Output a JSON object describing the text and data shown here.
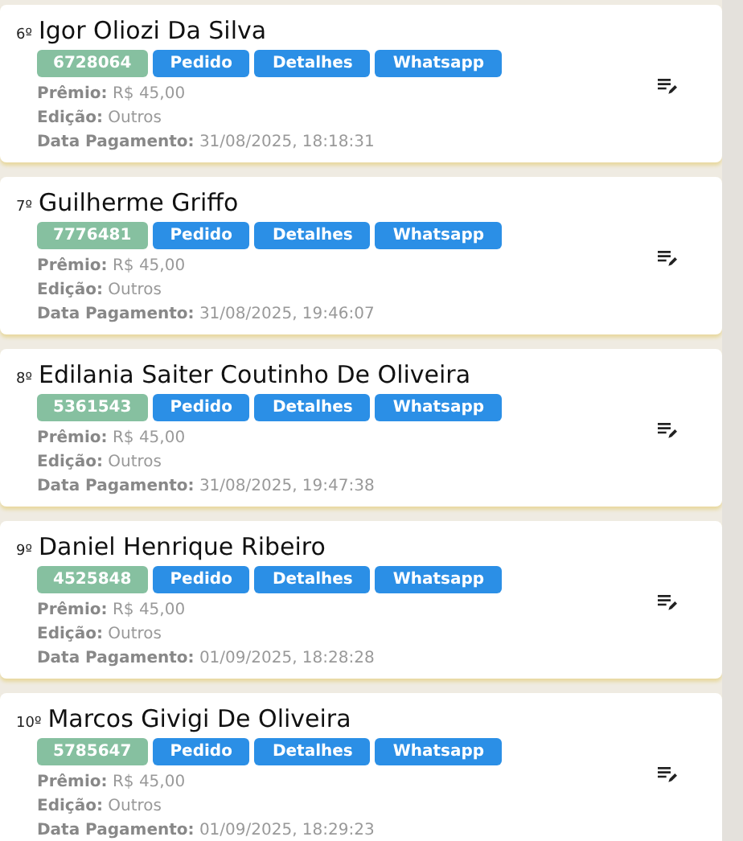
{
  "entries": [
    {
      "rank": "6º",
      "name": "Igor Oliozi Da Silva",
      "code": "6728064",
      "buttons": [
        "Pedido",
        "Detalhes",
        "Whatsapp"
      ],
      "fields": [
        {
          "label": "Prêmio:",
          "value": "R$ 45,00"
        },
        {
          "label": "Edição:",
          "value": "Outros"
        },
        {
          "label": "Data Pagamento:",
          "value": "31/08/2025, 18:18:31"
        }
      ]
    },
    {
      "rank": "7º",
      "name": "Guilherme Griffo",
      "code": "7776481",
      "buttons": [
        "Pedido",
        "Detalhes",
        "Whatsapp"
      ],
      "fields": [
        {
          "label": "Prêmio:",
          "value": "R$ 45,00"
        },
        {
          "label": "Edição:",
          "value": "Outros"
        },
        {
          "label": "Data Pagamento:",
          "value": "31/08/2025, 19:46:07"
        }
      ]
    },
    {
      "rank": "8º",
      "name": "Edilania Saiter Coutinho De Oliveira",
      "code": "5361543",
      "buttons": [
        "Pedido",
        "Detalhes",
        "Whatsapp"
      ],
      "fields": [
        {
          "label": "Prêmio:",
          "value": "R$ 45,00"
        },
        {
          "label": "Edição:",
          "value": "Outros"
        },
        {
          "label": "Data Pagamento:",
          "value": "31/08/2025, 19:47:38"
        }
      ]
    },
    {
      "rank": "9º",
      "name": "Daniel Henrique Ribeiro",
      "code": "4525848",
      "buttons": [
        "Pedido",
        "Detalhes",
        "Whatsapp"
      ],
      "fields": [
        {
          "label": "Prêmio:",
          "value": "R$ 45,00"
        },
        {
          "label": "Edição:",
          "value": "Outros"
        },
        {
          "label": "Data Pagamento:",
          "value": "01/09/2025, 18:28:28"
        }
      ]
    },
    {
      "rank": "10º",
      "name": "Marcos Givigi De Oliveira",
      "code": "5785647",
      "buttons": [
        "Pedido",
        "Detalhes",
        "Whatsapp"
      ],
      "fields": [
        {
          "label": "Prêmio:",
          "value": "R$ 45,00"
        },
        {
          "label": "Edição:",
          "value": "Outros"
        },
        {
          "label": "Data Pagamento:",
          "value": "01/09/2025, 18:29:23"
        }
      ]
    }
  ]
}
